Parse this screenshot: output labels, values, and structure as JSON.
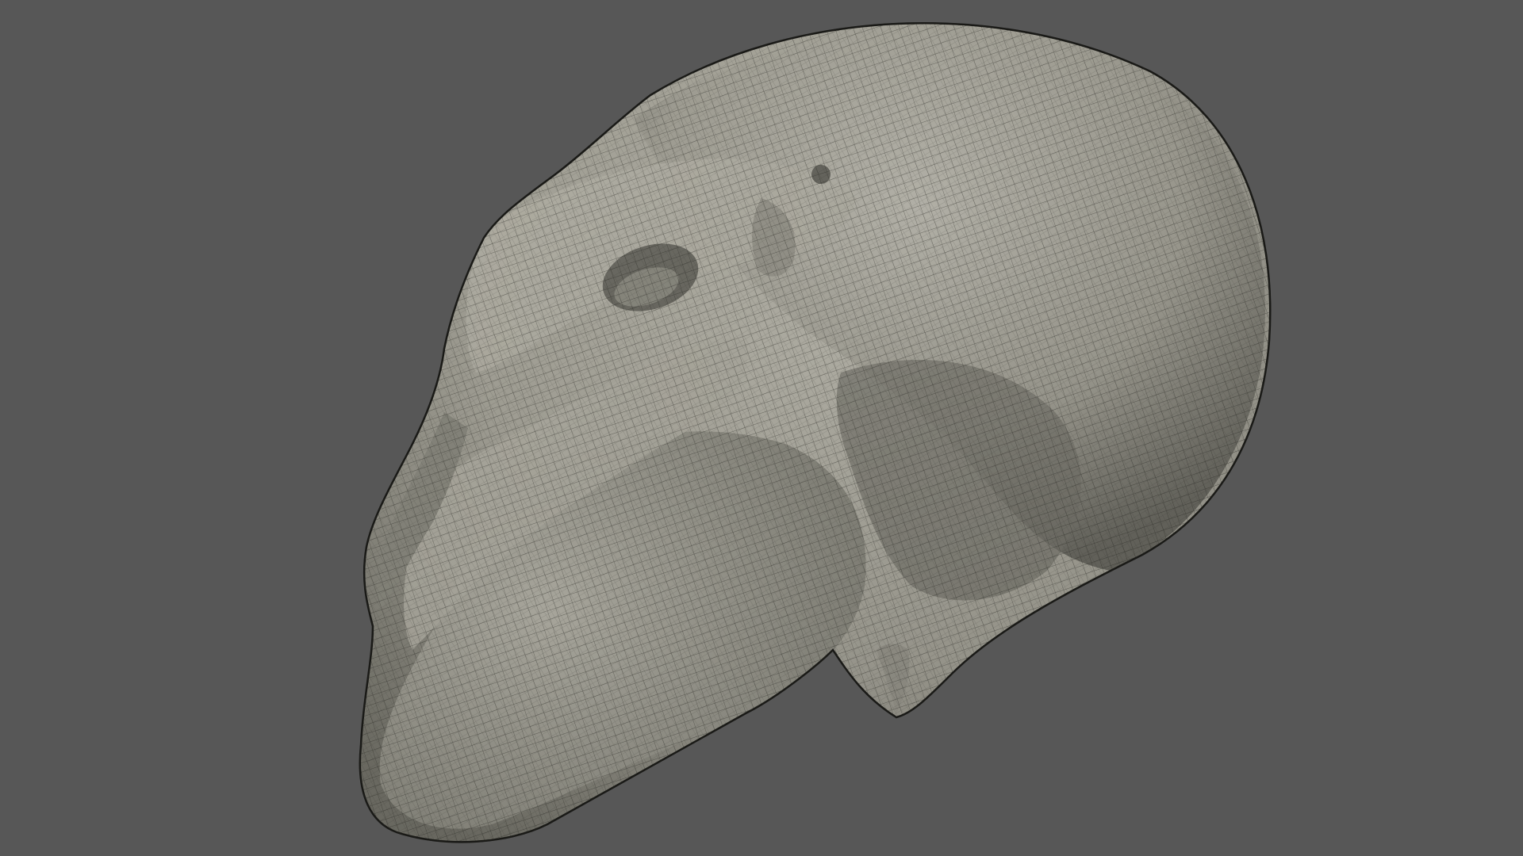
{
  "viewport": {
    "background_color": "#575757",
    "mesh": {
      "subject": "skull",
      "shading": "wireframe-on-shaded",
      "surface_color": "#a9a79c",
      "wire_color": "#1e1e1a"
    }
  }
}
